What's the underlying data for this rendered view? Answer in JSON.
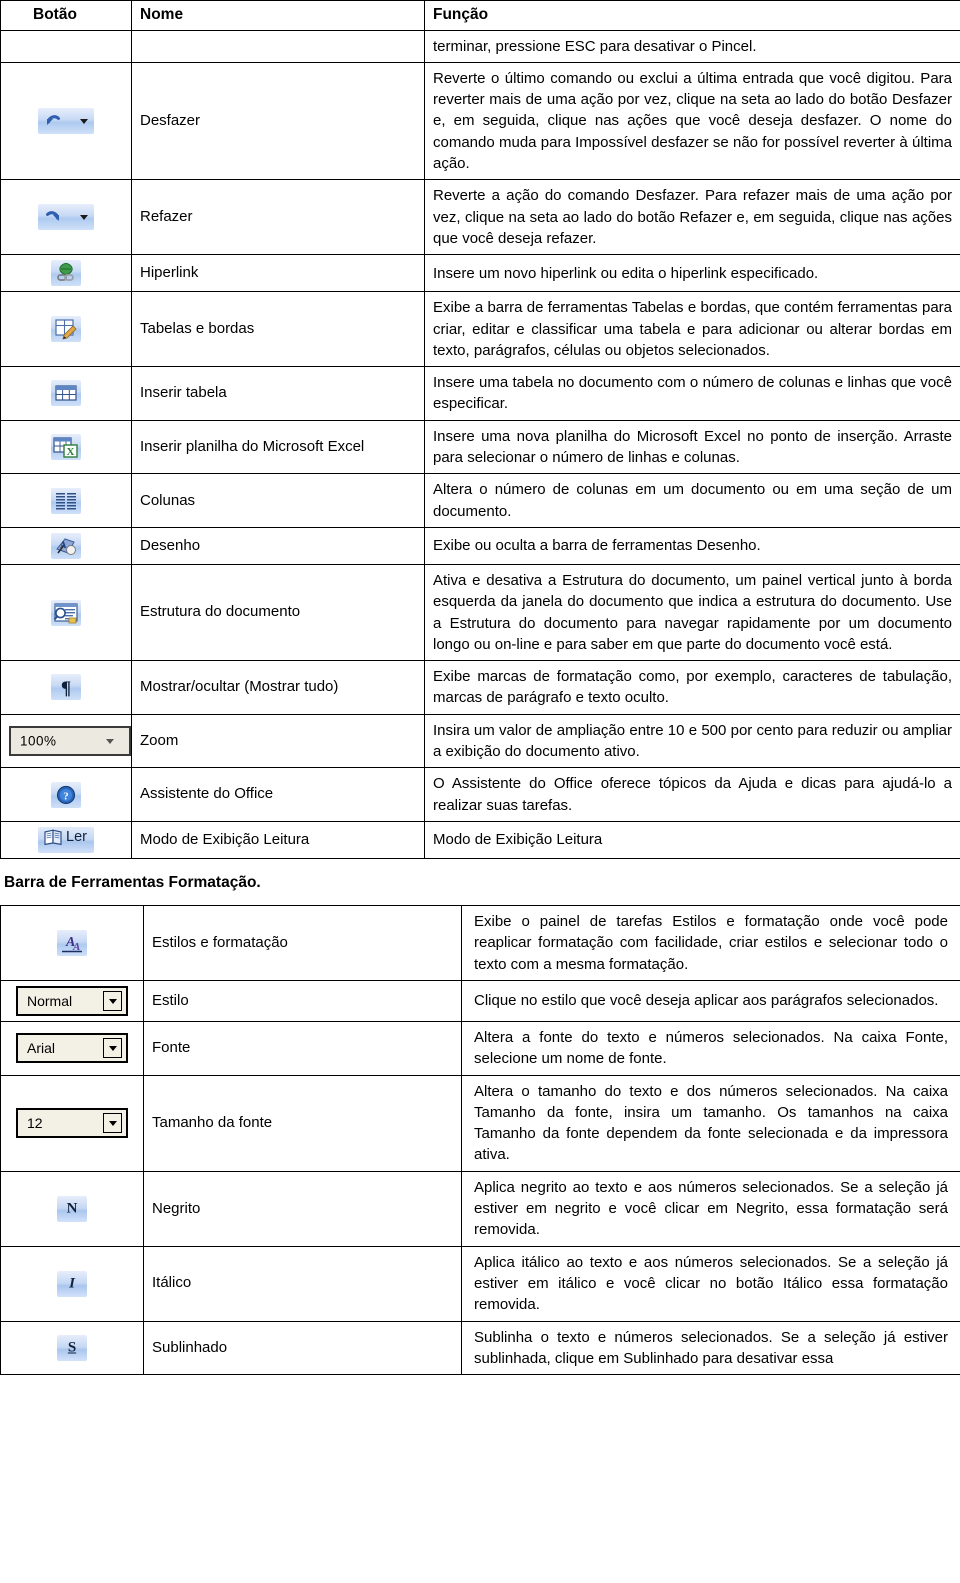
{
  "table1": {
    "headers": [
      "Botão",
      "Nome",
      "Função"
    ],
    "rows": [
      {
        "icon": "none",
        "name": "",
        "desc": "terminar, pressione ESC para desativar o Pincel."
      },
      {
        "icon": "undo-icon",
        "name": "Desfazer",
        "desc": "Reverte o último comando ou exclui a última entrada que você digitou. Para reverter mais de uma ação por vez, clique na seta ao lado do botão Desfazer e, em seguida, clique nas ações que você deseja desfazer. O nome do comando muda para Impossível desfazer se não for possível reverter à última ação."
      },
      {
        "icon": "redo-icon",
        "name": "Refazer",
        "desc": "Reverte a ação do comando Desfazer. Para refazer mais de uma ação por vez, clique na seta ao lado do botão Refazer e, em seguida, clique nas ações que você deseja refazer."
      },
      {
        "icon": "hyperlink-icon",
        "name": "Hiperlink",
        "desc": "Insere um novo hiperlink ou edita o hiperlink especificado."
      },
      {
        "icon": "tables-and-borders-icon",
        "name": "Tabelas e bordas",
        "desc": "Exibe a barra de ferramentas Tabelas e bordas, que contém ferramentas para criar, editar e classificar uma tabela e para adicionar ou alterar bordas em texto, parágrafos, células ou objetos selecionados."
      },
      {
        "icon": "insert-table-icon",
        "name": "Inserir tabela",
        "desc": "Insere uma tabela no documento com o número de colunas e linhas que você especificar."
      },
      {
        "icon": "insert-excel-worksheet-icon",
        "name": "Inserir planilha do Microsoft Excel",
        "desc": "Insere uma nova planilha do Microsoft Excel no ponto de inserção. Arraste para selecionar o número de linhas e colunas."
      },
      {
        "icon": "columns-icon",
        "name": "Colunas",
        "desc": "Altera o número de colunas em um documento ou em uma seção de um documento."
      },
      {
        "icon": "drawing-icon",
        "name": "Desenho",
        "desc": "Exibe ou oculta a barra de ferramentas Desenho."
      },
      {
        "icon": "document-map-icon",
        "name": "Estrutura do documento",
        "desc": "Ativa e desativa a Estrutura do documento, um painel vertical junto à borda esquerda da janela do documento que indica a estrutura do documento. Use a Estrutura do documento para navegar rapidamente por um documento longo ou on-line e para saber em que parte do documento você está."
      },
      {
        "icon": "pilcrow-show-hide-icon",
        "name": "Mostrar/ocultar (Mostrar tudo)",
        "desc": "Exibe marcas de formatação como, por exemplo, caracteres de tabulação, marcas de parágrafo e texto oculto."
      },
      {
        "icon": "zoom-combo",
        "icon_value": "100%",
        "name": "Zoom",
        "desc": "Insira um valor de ampliação entre 10 e 500 por cento para reduzir ou ampliar a exibição do documento ativo."
      },
      {
        "icon": "office-assistant-icon",
        "name": "Assistente do Office",
        "desc": "O Assistente do Office oferece tópicos da Ajuda e dicas para ajudá-lo a realizar suas tarefas."
      },
      {
        "icon": "reading-layout-icon",
        "icon_value": "Ler",
        "name": "Modo de Exibição Leitura",
        "desc": "Modo de Exibição Leitura"
      }
    ]
  },
  "caption": "Barra de Ferramentas Formatação.",
  "table2": {
    "rows": [
      {
        "icon": "styles-and-formatting-icon",
        "name": "Estilos e formatação",
        "desc": "Exibe o painel de tarefas Estilos e formatação onde você pode reaplicar formatação com facilidade, criar estilos e selecionar todo o texto com a mesma formatação."
      },
      {
        "icon": "style-combo",
        "icon_value": "Normal",
        "name": "Estilo",
        "desc": "Clique no estilo que você deseja aplicar aos parágrafos selecionados."
      },
      {
        "icon": "font-combo",
        "icon_value": "Arial",
        "name": "Fonte",
        "desc": "Altera a fonte do texto e números selecionados. Na caixa Fonte, selecione um nome de fonte."
      },
      {
        "icon": "font-size-combo",
        "icon_value": "12",
        "name": "Tamanho da fonte",
        "desc": "Altera o tamanho do texto e dos números selecionados. Na caixa Tamanho da fonte, insira um tamanho. Os tamanhos na caixa Tamanho da fonte dependem da fonte selecionada e da impressora ativa."
      },
      {
        "icon": "bold-icon",
        "icon_value": "N",
        "name": "Negrito",
        "desc": "Aplica negrito ao texto e aos números selecionados. Se a seleção já estiver em negrito e você clicar em Negrito, essa formatação será removida."
      },
      {
        "icon": "italic-icon",
        "icon_value": "I",
        "name": "Itálico",
        "desc": "Aplica itálico ao texto e aos números selecionados. Se a seleção já estiver em itálico e você clicar no botão Itálico essa formatação removida."
      },
      {
        "icon": "underline-icon",
        "icon_value": "S",
        "name": "Sublinhado",
        "desc": "Sublinha o texto e números selecionados. Se a seleção já estiver sublinhada, clique em Sublinhado para desativar essa"
      }
    ]
  },
  "colors": {
    "button_face_light": "#e7eefb",
    "button_face_mid": "#aecaf0",
    "ink": "#000000",
    "icon_blue": "#2a5caa",
    "icon_green": "#3f9a4a"
  }
}
